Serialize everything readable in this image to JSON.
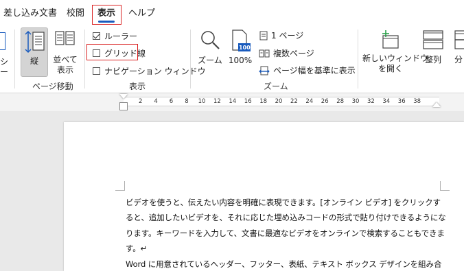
{
  "tabs": [
    {
      "label": "差し込み文書",
      "active": false
    },
    {
      "label": "校閲",
      "active": false
    },
    {
      "label": "表示",
      "active": true
    },
    {
      "label": "ヘルプ",
      "active": false
    }
  ],
  "ribbon": {
    "left_cut": {
      "line1": "シ",
      "line2": "ー"
    },
    "page_move": {
      "vertical_label": "縦",
      "side_label_1": "並べて",
      "side_label_2": "表示",
      "group_label": "ページ移動"
    },
    "show": {
      "ruler_label": "ルーラー",
      "ruler_checked": true,
      "grid_label": "グリッド線",
      "grid_checked": false,
      "nav_label": "ナビゲーション ウィンドウ",
      "nav_checked": false,
      "group_label": "表示"
    },
    "zoom": {
      "zoom_label": "ズーム",
      "hundred_label": "100%",
      "hundred_icon_text": "100",
      "one_page_label": "1 ページ",
      "multi_page_label": "複数ページ",
      "page_width_label": "ページ幅を基準に表示",
      "group_label": "ズーム"
    },
    "window": {
      "new_window_line1": "新しいウィンドウ",
      "new_window_line2": "を開く",
      "arrange_label": "整列",
      "split_label": "分"
    }
  },
  "ruler": {
    "ticks": [
      "2",
      "4",
      "6",
      "8",
      "10",
      "12",
      "14",
      "16",
      "18",
      "20",
      "22",
      "24",
      "26",
      "28",
      "30",
      "32",
      "34",
      "36",
      "38"
    ]
  },
  "document": {
    "lines": [
      "ビデオを使うと、伝えたい内容を明確に表現できます。[オンライン ビデオ] をクリックす",
      "ると、追加したいビデオを、それに応じた埋め込みコードの形式で貼り付けできるようにな",
      "ります。キーワードを入力して、文書に最適なビデオをオンラインで検索することもできま",
      "す。↵",
      "Word に用意されているヘッダー、フッター、表紙、テキスト ボックス デザインを組み合"
    ]
  },
  "colors": {
    "accent": "#185abd",
    "highlight": "#d92020",
    "doc_bg": "#e9e9e9"
  }
}
